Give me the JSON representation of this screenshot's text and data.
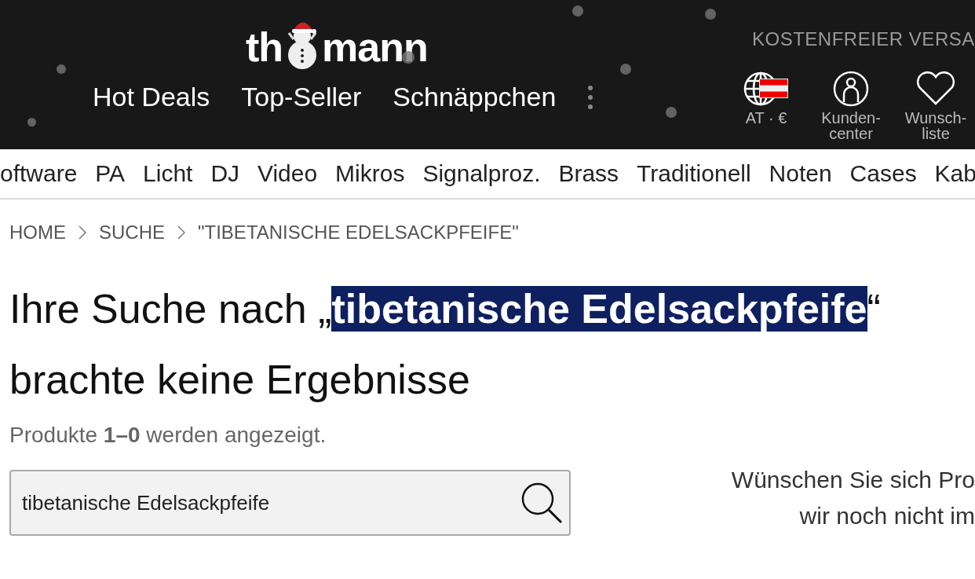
{
  "header": {
    "logo": {
      "before": "th",
      "after": "mann"
    },
    "nav": [
      "Hot Deals",
      "Top-Seller",
      "Schnäppchen"
    ],
    "promo": "KOSTENFREIER VERSA",
    "actions": [
      {
        "kind": "region",
        "label": "AT · €"
      },
      {
        "kind": "account",
        "label": "Kunden-\ncenter"
      },
      {
        "kind": "wishlist",
        "label": "Wunsch-\nliste"
      }
    ]
  },
  "categories": [
    "oftware",
    "PA",
    "Licht",
    "DJ",
    "Video",
    "Mikros",
    "Signalproz.",
    "Brass",
    "Traditionell",
    "Noten",
    "Cases",
    "Kab"
  ],
  "breadcrumb": [
    "HOME",
    "SUCHE",
    "\"TIBETANISCHE EDELSACKPFEIFE\""
  ],
  "heading": {
    "prefix": "Ihre Suche nach „",
    "query": "tibetanische Edelsackpfeife",
    "query_selected": true,
    "suffix": "“",
    "line2": "brachte keine Ergebnisse"
  },
  "count": "Produkte **1–0** werden angezeigt.",
  "search": {
    "value": "tibetanische Edelsackpfeife"
  },
  "suggestion": [
    "Wünschen Sie sich Pro",
    "wir noch nicht im"
  ]
}
